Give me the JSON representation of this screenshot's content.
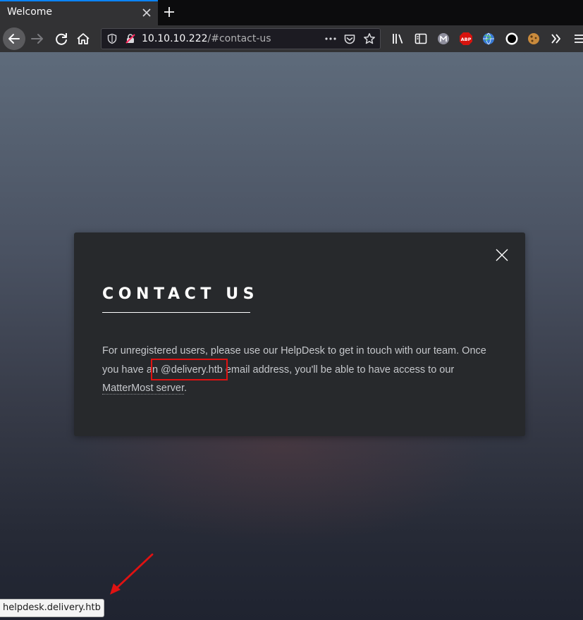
{
  "browser": {
    "tab": {
      "title": "Welcome"
    },
    "url": {
      "host": "10.10.10.222",
      "path": "/#contact-us"
    }
  },
  "modal": {
    "title": "CONTACT US",
    "body_pre": "For unregistered users, please use our HelpDesk to get in touch with our team. Once you have an ",
    "email_domain": "@delivery.htb",
    "body_mid": " email address, you'll be able to have access to our ",
    "link_text": "MatterMost server",
    "body_post": "."
  },
  "status_bar": {
    "text": "helpdesk.delivery.htb"
  },
  "colors": {
    "accent": "#0a84ff",
    "annotation": "#e01212",
    "abp": "#d7130e"
  },
  "icons": [
    "close-icon",
    "plus-icon",
    "back-arrow-icon",
    "forward-arrow-icon",
    "reload-icon",
    "home-icon",
    "shield-icon",
    "insecure-lock-icon",
    "more-dots-icon",
    "pocket-icon",
    "star-icon",
    "library-icon",
    "sidebar-icon",
    "m-extension-icon",
    "abp-icon",
    "globe-icon",
    "record-icon",
    "cookie-icon",
    "overflow-chevron-icon",
    "hamburger-menu-icon"
  ]
}
